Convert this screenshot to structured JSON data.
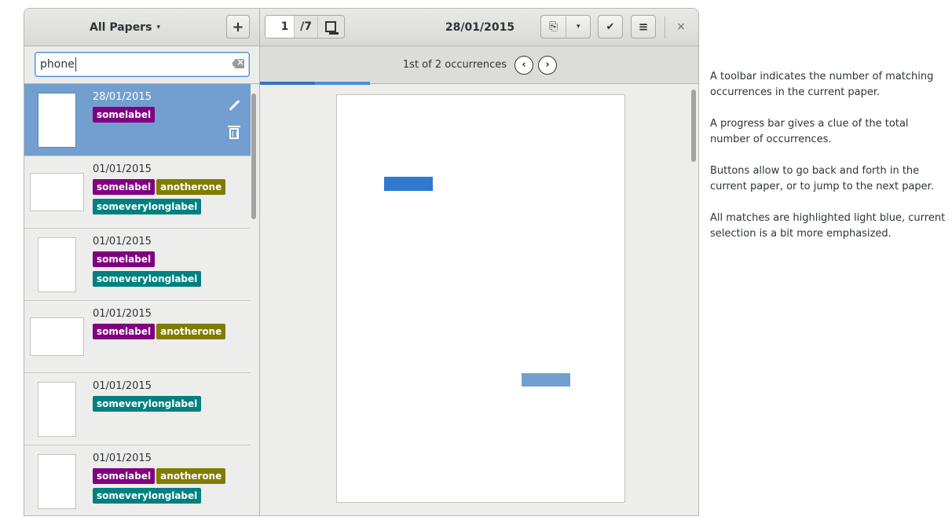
{
  "header": {
    "collection_label": "All Papers",
    "caret": "▾",
    "add_label": "+",
    "page_current": "1",
    "page_total": "/7",
    "date": "28/01/2015",
    "export_icon": "⎘",
    "export_caret": "▾",
    "check_label": "✔",
    "menu_label": "≡",
    "close_label": "×"
  },
  "search": {
    "value": "phone",
    "clear_icon": "clear-icon"
  },
  "papers": [
    {
      "date": "28/01/2015",
      "selected": true,
      "thumb": "portrait",
      "labels": [
        {
          "text": "somelabel",
          "color": "#800080"
        }
      ]
    },
    {
      "date": "01/01/2015",
      "selected": false,
      "thumb": "landscape",
      "labels": [
        {
          "text": "somelabel",
          "color": "#800080"
        },
        {
          "text": "anotherone",
          "color": "#807c00"
        },
        {
          "text": "someverylonglabel",
          "color": "#008080"
        }
      ]
    },
    {
      "date": "01/01/2015",
      "selected": false,
      "thumb": "portrait",
      "labels": [
        {
          "text": "somelabel",
          "color": "#800080"
        },
        {
          "text": "someverylonglabel",
          "color": "#008080"
        }
      ]
    },
    {
      "date": "01/01/2015",
      "selected": false,
      "thumb": "landscape",
      "labels": [
        {
          "text": "somelabel",
          "color": "#800080"
        },
        {
          "text": "anotherone",
          "color": "#807c00"
        }
      ]
    },
    {
      "date": "01/01/2015",
      "selected": false,
      "thumb": "portrait",
      "labels": [
        {
          "text": "someverylonglabel",
          "color": "#008080"
        }
      ]
    },
    {
      "date": "01/01/2015",
      "selected": false,
      "thumb": "portrait",
      "labels": [
        {
          "text": "somelabel",
          "color": "#800080"
        },
        {
          "text": "anotherone",
          "color": "#807c00"
        },
        {
          "text": "someverylonglabel",
          "color": "#008080"
        }
      ]
    }
  ],
  "findbar": {
    "occurrences": "1st of 2 occurrences",
    "prev_label": "‹",
    "next_label": "›",
    "progress_total_fraction": 0.25,
    "progress_current_fraction": 0.125
  },
  "highlights": {
    "current_color": "#3079d0",
    "other_color": "#729fcf"
  },
  "annotation": {
    "p1": "A toolbar indicates the number of matching occurrences in the current paper.",
    "p2": "A progress bar gives a  clue of the total number of occurrences.",
    "p3": "Buttons allow to go back and forth in the current paper, or to jump to the next paper.",
    "p4": "All matches are highlighted light blue, current selection is a bit more emphasized."
  }
}
